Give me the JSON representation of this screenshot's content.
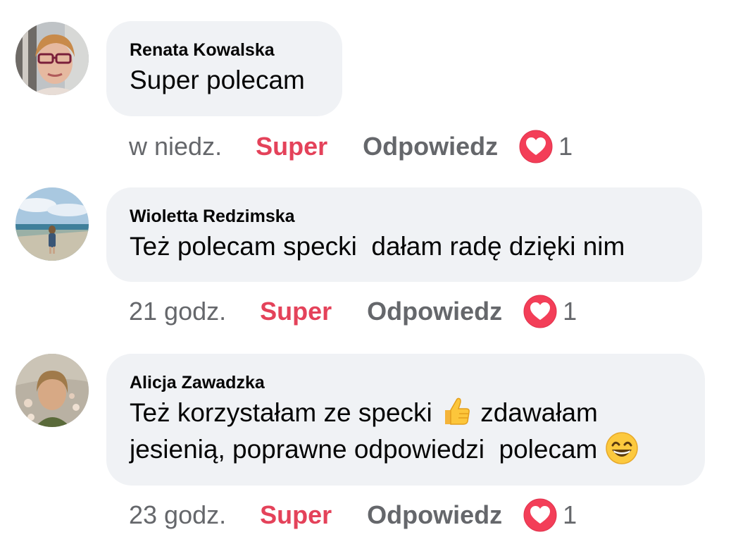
{
  "comments": [
    {
      "author": "Renata Kowalska",
      "text": "Super polecam",
      "time": "w niedz.",
      "like_label": "Super",
      "reply_label": "Odpowiedz",
      "reaction_icon": "heart-reaction-icon",
      "reaction_count": "1"
    },
    {
      "author": "Wioletta Redzimska",
      "text": "Też polecam specki  dałam radę dzięki nim",
      "time": "21 godz.",
      "like_label": "Super",
      "reply_label": "Odpowiedz",
      "reaction_icon": "heart-reaction-icon",
      "reaction_count": "1"
    },
    {
      "author": "Alicja Zawadzka",
      "text_part1": "Też korzystałam ze specki ",
      "text_part2": " zdawałam",
      "text_part3": "jesienią, poprawne odpowiedzi  polecam ",
      "emoji1": "thumbs-up-emoji",
      "emoji2": "grinning-face-emoji",
      "time": "23 godz.",
      "like_label": "Super",
      "reply_label": "Odpowiedz",
      "reaction_icon": "heart-reaction-icon",
      "reaction_count": "1"
    }
  ],
  "colors": {
    "bubble_bg": "#f0f2f5",
    "text": "#050505",
    "meta": "#65676b",
    "like_active": "#e4425a",
    "heart": "#f33e58"
  }
}
